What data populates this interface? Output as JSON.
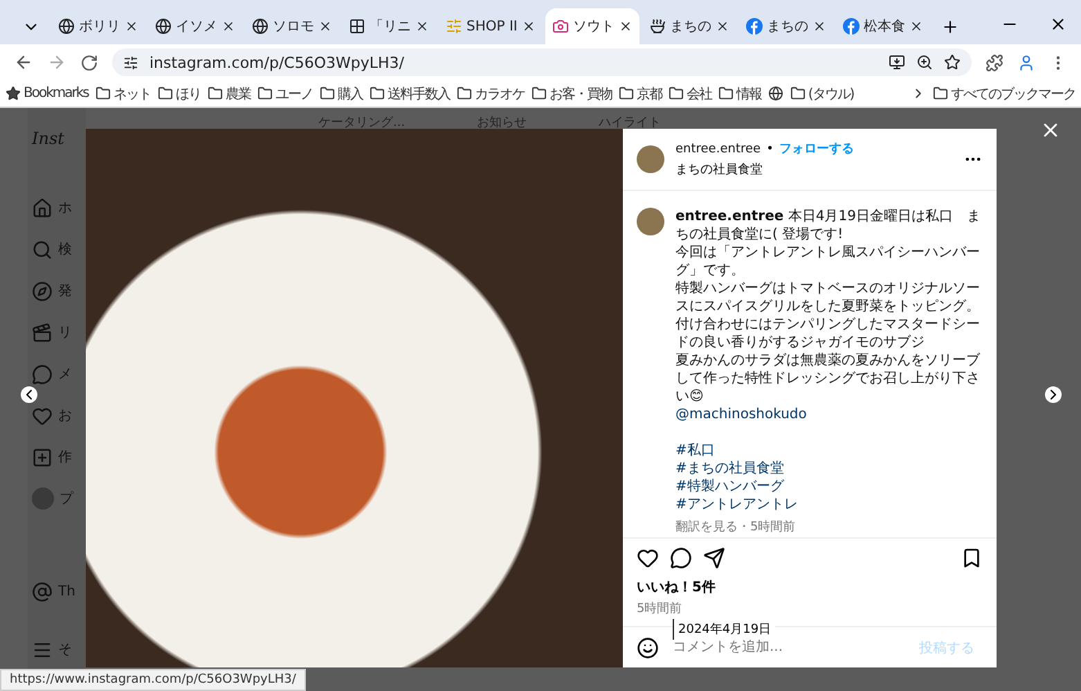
{
  "tabs": [
    {
      "title": "ボリリ",
      "kind": "globe",
      "selected": false
    },
    {
      "title": "イソメ",
      "kind": "globe",
      "selected": false
    },
    {
      "title": "ソロモ",
      "kind": "globe",
      "selected": false
    },
    {
      "title": "「リニ",
      "kind": "grid",
      "selected": false
    },
    {
      "title": "SHOP II",
      "kind": "letter",
      "selected": false
    },
    {
      "title": "ソウト",
      "kind": "camera",
      "selected": true
    },
    {
      "title": "まちの",
      "kind": "bowl",
      "selected": false
    },
    {
      "title": "まちの",
      "kind": "facebook",
      "selected": false
    },
    {
      "title": "松本食",
      "kind": "facebook",
      "selected": false
    }
  ],
  "address": {
    "url": "instagram.com/p/C56O3WpyLH3/"
  },
  "bookmarks": [
    {
      "label": "Bookmarks",
      "kind": "star"
    },
    {
      "label": "ネット",
      "kind": "folder"
    },
    {
      "label": "ほり",
      "kind": "folder"
    },
    {
      "label": "農業",
      "kind": "folder"
    },
    {
      "label": "ユーノ",
      "kind": "folder"
    },
    {
      "label": "購入",
      "kind": "folder"
    },
    {
      "label": "送料手数入",
      "kind": "folder"
    },
    {
      "label": "カラオケ",
      "kind": "folder"
    },
    {
      "label": "お客・買物",
      "kind": "folder"
    },
    {
      "label": "京都",
      "kind": "folder"
    },
    {
      "label": "会社",
      "kind": "folder"
    },
    {
      "label": "情報",
      "kind": "folder"
    },
    {
      "kind": "globe"
    },
    {
      "label": "(タウル)",
      "kind": "folder"
    }
  ],
  "all_bookmarks": "すべてのブックマーク",
  "page": {
    "logo": "Inst",
    "sidebar": [
      {
        "label": "ホ",
        "kind": "home"
      },
      {
        "label": "検",
        "kind": "search"
      },
      {
        "label": "発",
        "kind": "compass"
      },
      {
        "label": "リ",
        "kind": "reels"
      },
      {
        "label": "メ",
        "kind": "messenger"
      },
      {
        "label": "お",
        "kind": "heart"
      },
      {
        "label": "作",
        "kind": "plus"
      },
      {
        "label": "プ",
        "kind": "avatar"
      }
    ],
    "sidebar_bottom": [
      {
        "label": "Th",
        "kind": "threads"
      },
      {
        "label": "そ",
        "kind": "menu"
      }
    ],
    "top_links": [
      "ケータリング...",
      "お知らせ",
      "ハイライト"
    ]
  },
  "post": {
    "username": "entree.entree",
    "separator": "•",
    "follow": "フォローする",
    "location": "まちの社員食堂",
    "caption_username": "entree.entree",
    "caption_lead": "本日4月19日金曜日は私口　まちの社員食堂に( 登場です!",
    "caption_lines": [
      "今回は「アントレアントレ風スパイシーハンバーグ」です。",
      "特製ハンバーグはトマトベースのオリジナルソースにスパイスグリルをした夏野菜をトッピング。",
      "付け合わせにはテンパリングしたマスタードシードの良い香りがするジャガイモのサブジ",
      "夏みかんのサラダは無農薬の夏みかんをソリーブして作った特性ドレッシングでお召し上がり下さい😊"
    ],
    "mention": "@machinoshokudo",
    "hashtags": [
      "#私口",
      "#まちの社員食堂",
      "#特製ハンバーグ",
      "#アントレアントレ"
    ],
    "meta": "翻訳を見る・5時間前",
    "likes": "いいね！5件",
    "time": "5時間前",
    "tooltip": "2024年4月19日",
    "comment_placeholder": "コメントを追加...",
    "post_button": "投稿する"
  },
  "status_url": "https://www.instagram.com/p/C56O3WpyLH3/"
}
